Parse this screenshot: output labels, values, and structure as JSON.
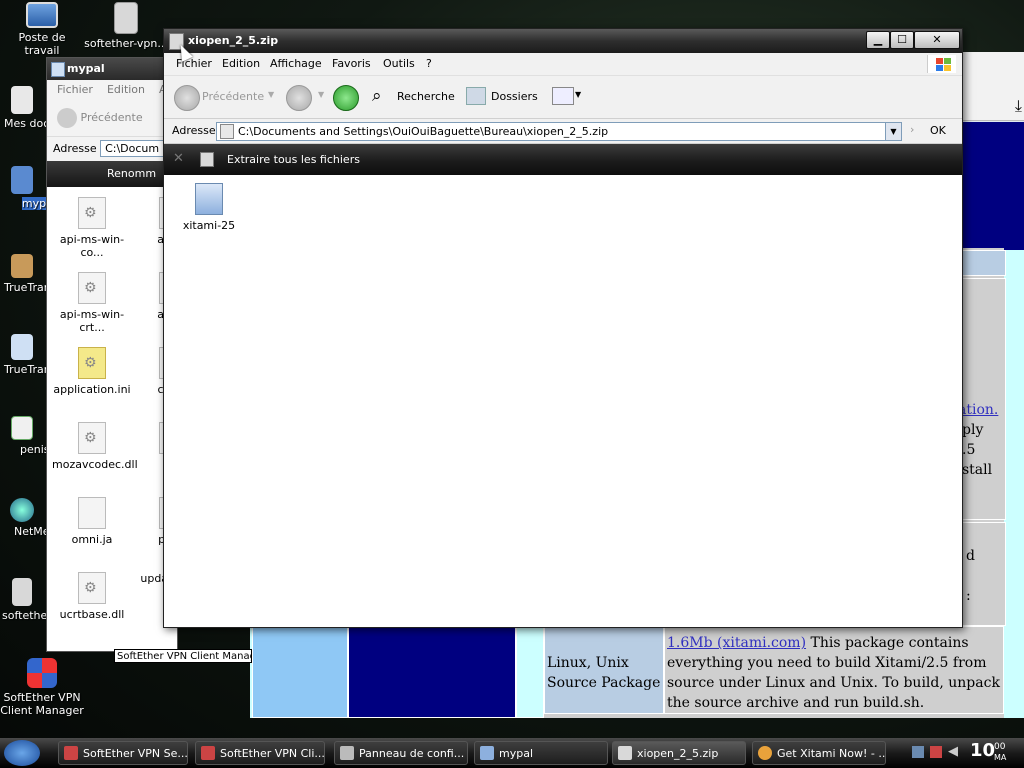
{
  "desktop": {
    "icons": [
      {
        "label": "Poste de travail"
      },
      {
        "label": "softether-vpn..."
      },
      {
        "label": "Mes doc"
      },
      {
        "label": "myp"
      },
      {
        "label": "TrueTran"
      },
      {
        "label": "TrueTran"
      },
      {
        "label": "penis"
      },
      {
        "label": "NetMe"
      },
      {
        "label": "softethe"
      },
      {
        "label": "SoftEther VPN Client Manager"
      }
    ]
  },
  "browser": {
    "link_fragment": "ation.",
    "fragments": [
      "ply",
      ".5",
      "stall",
      "d",
      ":"
    ],
    "row": {
      "label": "Linux, Unix Source Package",
      "link": "1.6Mb (xitami.com)",
      "description": " This package contains everything you need to build Xitami/2.5 from source under Linux and Unix. To build, unpack the source archive and run build.sh."
    }
  },
  "mypal_window": {
    "title": "mypal",
    "menu": [
      "Fichier",
      "Edition",
      "Af"
    ],
    "back_label": "Précédente",
    "address_label": "Adresse",
    "address_value": "C:\\Docum",
    "task_label": "Renomm",
    "files": [
      {
        "name": "api-ms-win-co...",
        "name2": "api-m"
      },
      {
        "name": "api-ms-win-crt...",
        "name2": "api-m"
      },
      {
        "name": "application.ini",
        "name2": "chron"
      },
      {
        "name": "mozavcodec.dll",
        "name2": "mo"
      },
      {
        "name": "omni.ja",
        "name2": "pings"
      },
      {
        "name": "ucrtbase.dll",
        "name2": "updater.exe"
      }
    ],
    "stub_tooltip": "SoftEther VPN Client Manag"
  },
  "main_window": {
    "title": "xiopen_2_5.zip",
    "menu": [
      "Fichier",
      "Edition",
      "Affichage",
      "Favoris",
      "Outils",
      "?"
    ],
    "toolbar": {
      "back": "Précédente",
      "search": "Recherche",
      "folders": "Dossiers"
    },
    "address": {
      "label": "Adresse",
      "value": "C:\\Documents and Settings\\OuiOuiBaguette\\Bureau\\xiopen_2_5.zip",
      "go": "OK"
    },
    "task": "Extraire tous les fichiers",
    "items": [
      {
        "name": "xitami-25"
      }
    ]
  },
  "taskbar": {
    "buttons": [
      {
        "label": "SoftEther VPN Se..."
      },
      {
        "label": "SoftEther VPN Cli..."
      },
      {
        "label": "Panneau de confi..."
      },
      {
        "label": "mypal"
      },
      {
        "label": "xiopen_2_5.zip"
      },
      {
        "label": "Get Xitami Now! - ..."
      }
    ],
    "clock": {
      "time": "10",
      "minutes": "00",
      "ampm": "MA"
    }
  },
  "colors": {
    "browser_navy": "#000080",
    "browser_cyan": "#ccffff",
    "table_blue": "#b8cde3",
    "light_blue_cell": "#8fc8f5"
  }
}
